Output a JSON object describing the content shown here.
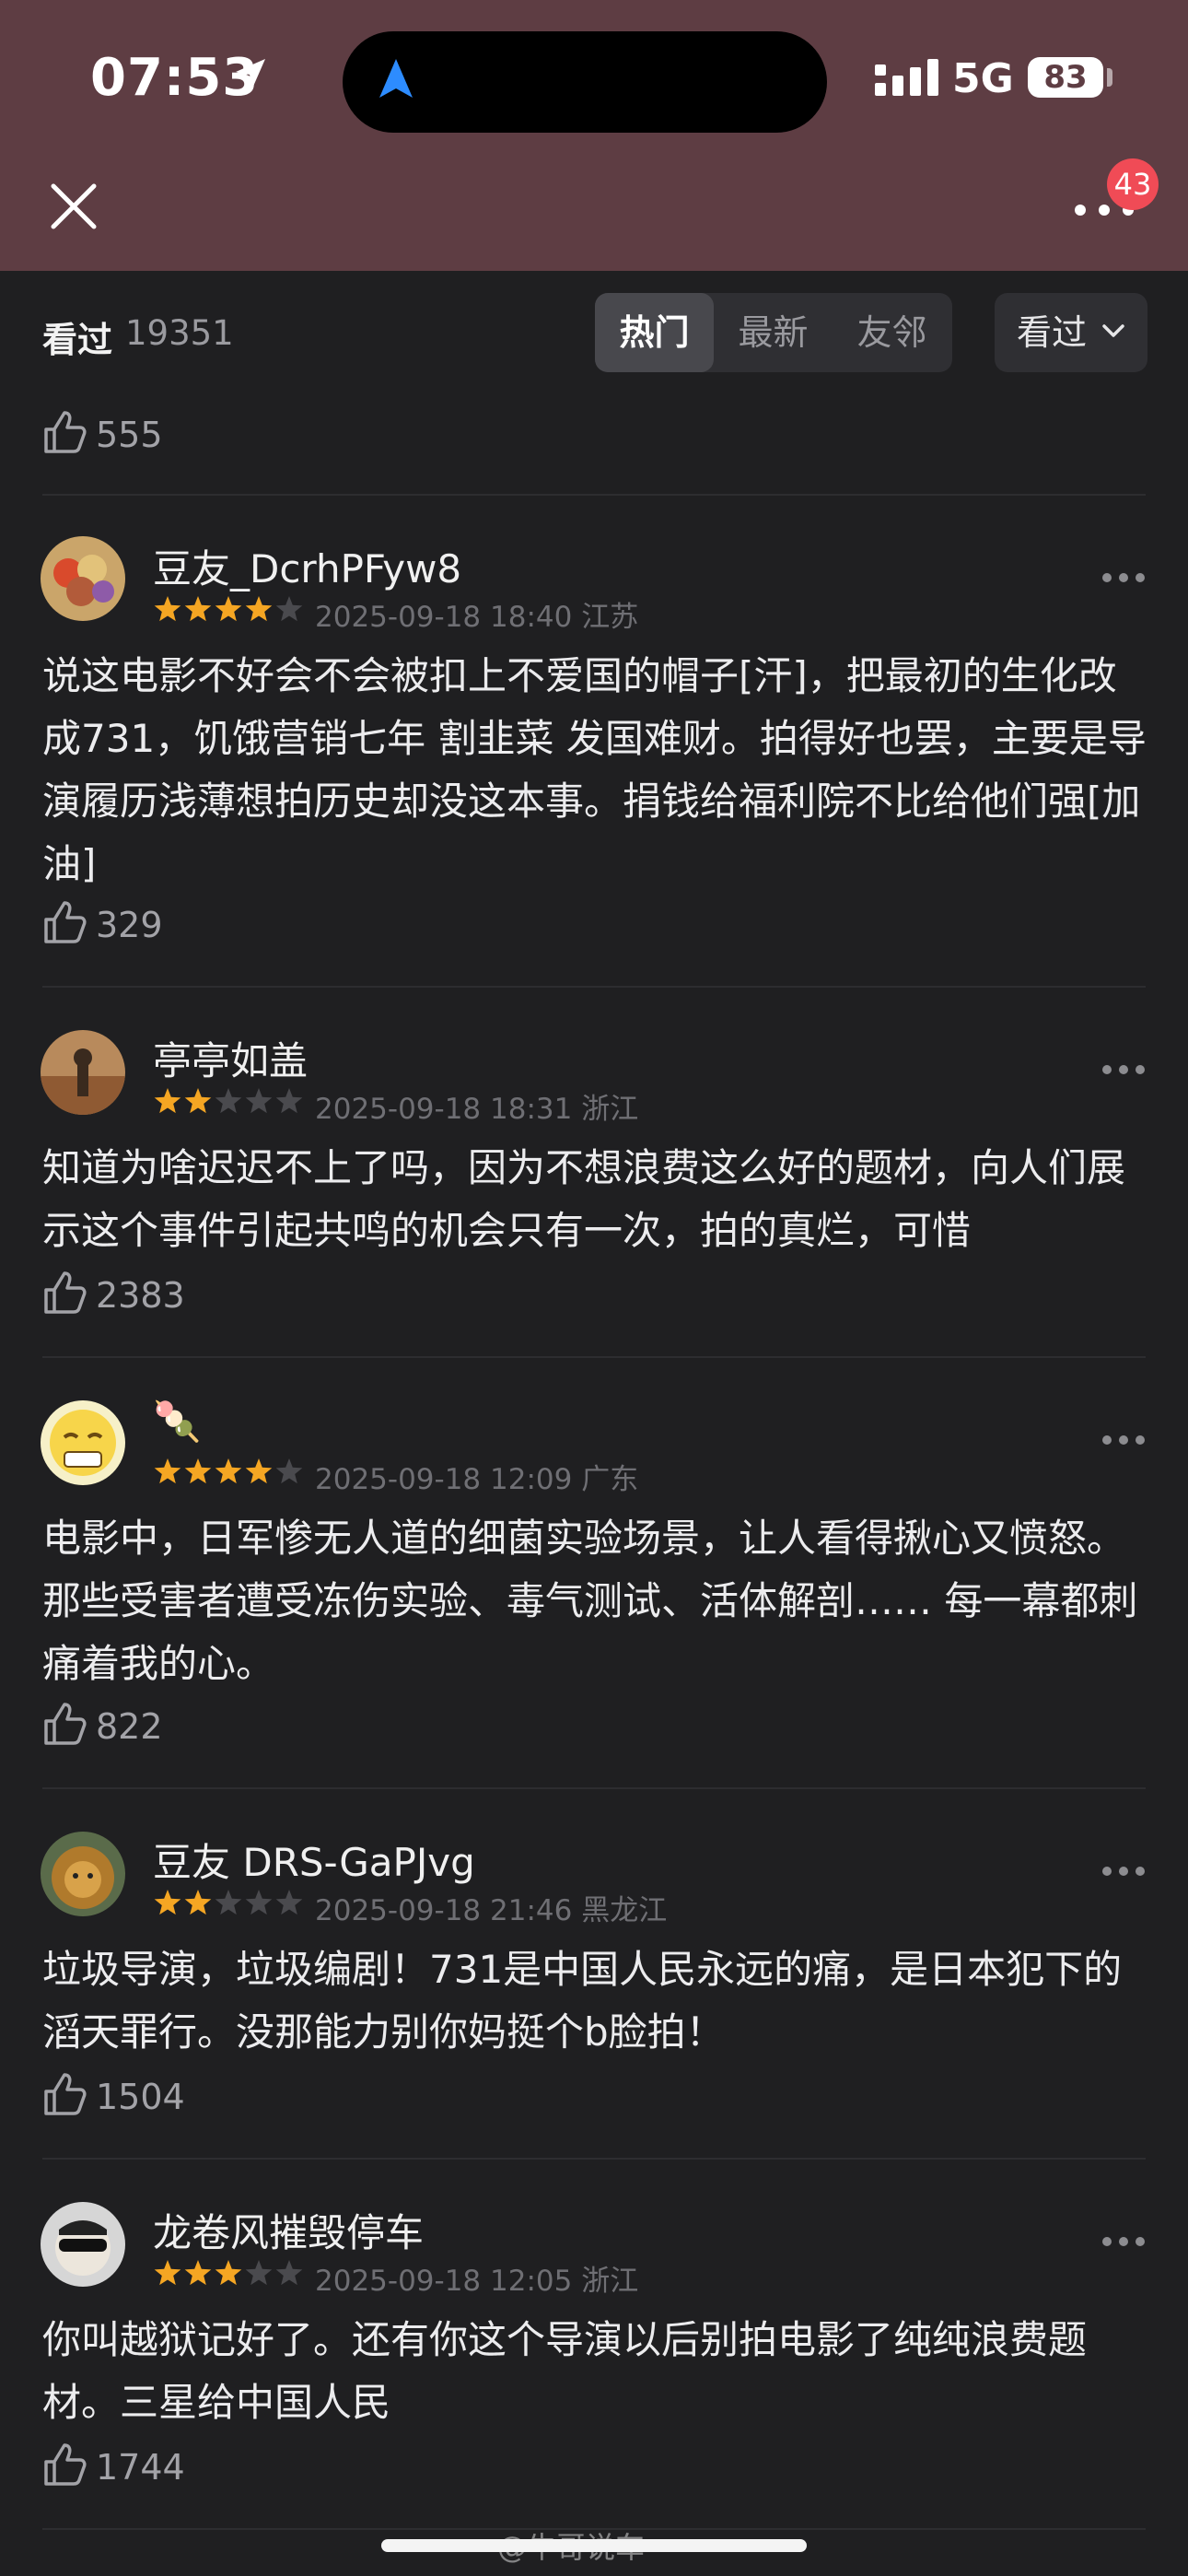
{
  "status_bar": {
    "time": "07:53",
    "network": "5G",
    "battery": "83"
  },
  "header": {
    "notification_count": "43"
  },
  "filter": {
    "seen_label": "看过",
    "seen_count": "19351",
    "tabs": [
      "热门",
      "最新",
      "友邻"
    ],
    "active_tab": "热门",
    "dropdown_label": "看过"
  },
  "top_partial_likes": "555",
  "comments": [
    {
      "user": "豆友_DcrhPFyw8",
      "rating": 4,
      "date": "2025-09-18 18:40",
      "location": "江苏",
      "text": "说这电影不好会不会被扣上不爱国的帽子[汗]，把最初的生化改成731，饥饿营销七年 割韭菜 发国难财。拍得好也罢，主要是导演履历浅薄想拍历史却没这本事。捐钱给福利院不比给他们强[加油]",
      "likes": "329"
    },
    {
      "user": "亭亭如盖",
      "rating": 2,
      "date": "2025-09-18 18:31",
      "location": "浙江",
      "text": "知道为啥迟迟不上了吗，因为不想浪费这么好的题材，向人们展示这个事件引起共鸣的机会只有一次，拍的真烂，可惜",
      "likes": "2383"
    },
    {
      "user": "🍡",
      "rating": 4,
      "date": "2025-09-18 12:09",
      "location": "广东",
      "text": "电影中，日军惨无人道的细菌实验场景，让人看得揪心又愤怒。那些受害者遭受冻伤实验、毒气测试、活体解剖…… 每一幕都刺痛着我的心。",
      "likes": "822"
    },
    {
      "user": "豆友 DRS-GaPJvg",
      "rating": 2,
      "date": "2025-09-18 21:46",
      "location": "黑龙江",
      "text": "垃圾导演，垃圾编剧！731是中国人民永远的痛，是日本犯下的滔天罪行。没那能力别你妈挺个b脸拍！",
      "likes": "1504"
    },
    {
      "user": "龙卷风摧毁停车",
      "rating": 3,
      "date": "2025-09-18 12:05",
      "location": "浙江",
      "text": "你叫越狱记好了。还有你这个导演以后别拍电影了纯纯浪费题材。三星给中国人民",
      "likes": "1744"
    }
  ],
  "watermark": "@牛哥说车",
  "colors": {
    "star": "#f5a623",
    "star_empty": "#4a4a4e",
    "header_bg": "#5e3d43",
    "page_bg": "#1f1f21"
  }
}
